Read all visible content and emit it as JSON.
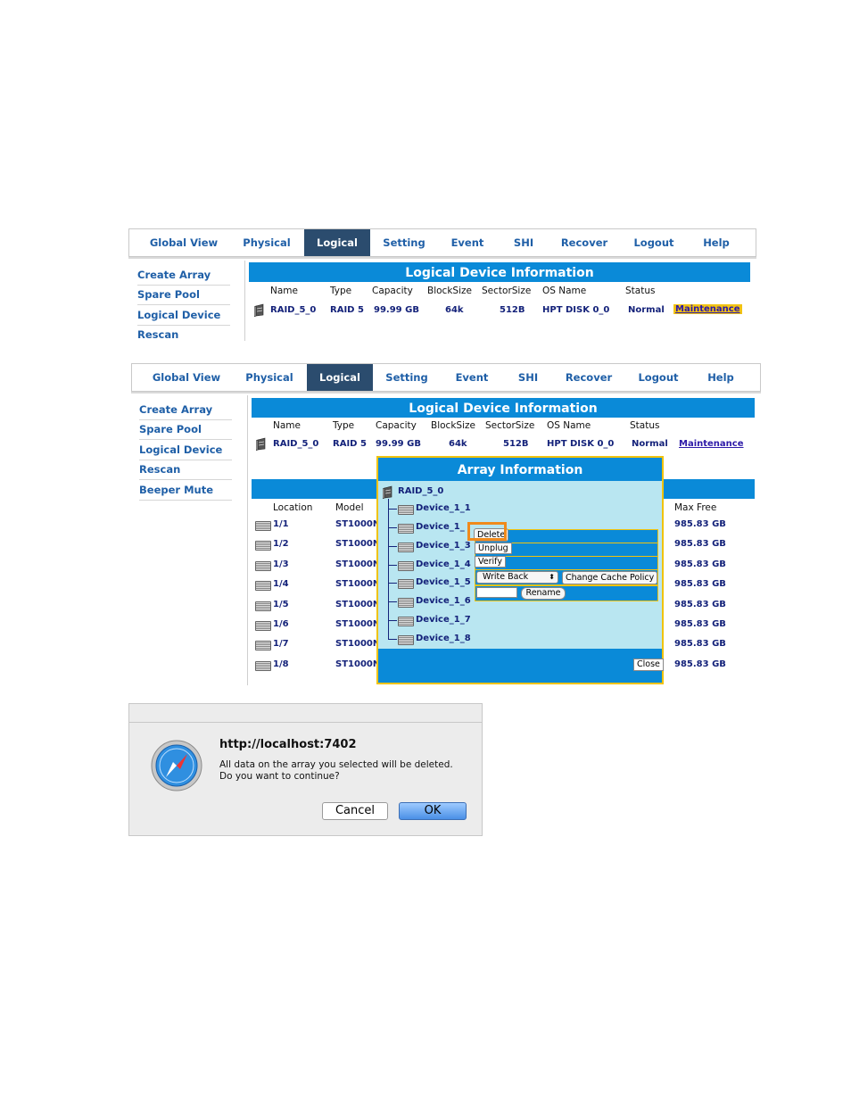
{
  "nav_tabs": [
    "Global View",
    "Physical",
    "Logical",
    "Setting",
    "Event",
    "SHI",
    "Recover",
    "Logout",
    "Help"
  ],
  "sidebar1": [
    "Create Array",
    "Spare Pool",
    "Logical Device",
    "Rescan"
  ],
  "sidebar2": [
    "Create Array",
    "Spare Pool",
    "Logical Device",
    "Rescan",
    "Beeper Mute"
  ],
  "logical_info": {
    "title": "Logical Device Information",
    "headers": [
      "Name",
      "Type",
      "Capacity",
      "BlockSize",
      "SectorSize",
      "OS Name",
      "Status"
    ],
    "row": [
      "RAID_5_0",
      "RAID 5",
      "99.99 GB",
      "64k",
      "512B",
      "HPT DISK 0_0",
      "Normal"
    ],
    "action": "Maintenance"
  },
  "physical": {
    "headers": [
      "Location",
      "Model",
      "Max Free"
    ],
    "rows": [
      {
        "loc": "1/1",
        "model": "ST1000N",
        "free": "985.83 GB"
      },
      {
        "loc": "1/2",
        "model": "ST1000N",
        "free": "985.83 GB"
      },
      {
        "loc": "1/3",
        "model": "ST1000N",
        "free": "985.83 GB"
      },
      {
        "loc": "1/4",
        "model": "ST1000N",
        "free": "985.83 GB"
      },
      {
        "loc": "1/5",
        "model": "ST1000N",
        "free": "985.83 GB"
      },
      {
        "loc": "1/6",
        "model": "ST1000N",
        "free": "985.83 GB"
      },
      {
        "loc": "1/7",
        "model": "ST1000N",
        "free": "985.83 GB"
      },
      {
        "loc": "1/8",
        "model": "ST1000N",
        "free": "985.83 GB"
      }
    ]
  },
  "array_info": {
    "title": "Array Information",
    "root": "RAID_5_0",
    "devices": [
      "Device_1_1",
      "Device_1_",
      "Device_1_3",
      "Device_1_4",
      "Device_1_5",
      "Device_1_6",
      "Device_1_7",
      "Device_1_8"
    ],
    "menu": {
      "delete": "Delete",
      "unplug": "Unplug",
      "verify": "Verify",
      "cache_select": "Write Back",
      "cache_button": "Change Cache Policy",
      "rename_value": "",
      "rename_button": "Rename"
    },
    "close": "Close"
  },
  "dialog": {
    "title": "http://localhost:7402",
    "message": "All data on the array you selected will be deleted. Do you want to continue?",
    "cancel": "Cancel",
    "ok": "OK"
  },
  "colors": {
    "accent_blue": "#0a8ad8",
    "nav_active": "#2b4c6e",
    "highlight_orange": "#f08a1c",
    "highlight_yellow": "#f0c30e"
  }
}
